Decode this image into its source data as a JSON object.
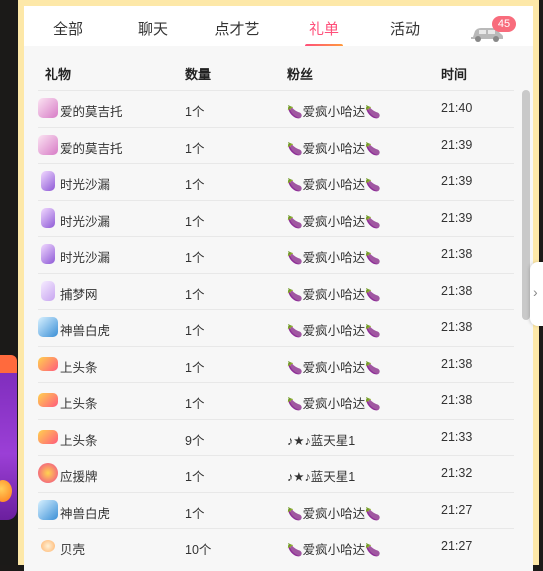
{
  "tabs": [
    {
      "label": "全部"
    },
    {
      "label": "聊天"
    },
    {
      "label": "点才艺"
    },
    {
      "label": "礼单",
      "active": true
    },
    {
      "label": "活动"
    }
  ],
  "car_badge": "45",
  "columns": {
    "gift": "礼物",
    "qty": "数量",
    "fan": "粉丝",
    "time": "时间"
  },
  "rows": [
    {
      "icon": "mozart-gift-icon",
      "gift": "爱的莫吉托",
      "qty": "1个",
      "fan": "🍆爱疯小哈达🍆",
      "time": "21:40"
    },
    {
      "icon": "mozart-gift-icon",
      "gift": "爱的莫吉托",
      "qty": "1个",
      "fan": "🍆爱疯小哈达🍆",
      "time": "21:39"
    },
    {
      "icon": "hourglass-gift-icon",
      "gift": "时光沙漏",
      "qty": "1个",
      "fan": "🍆爱疯小哈达🍆",
      "time": "21:39"
    },
    {
      "icon": "hourglass-gift-icon",
      "gift": "时光沙漏",
      "qty": "1个",
      "fan": "🍆爱疯小哈达🍆",
      "time": "21:39"
    },
    {
      "icon": "hourglass-gift-icon",
      "gift": "时光沙漏",
      "qty": "1个",
      "fan": "🍆爱疯小哈达🍆",
      "time": "21:38"
    },
    {
      "icon": "dreamcatcher-gift-icon",
      "gift": "捕梦网",
      "qty": "1个",
      "fan": "🍆爱疯小哈达🍆",
      "time": "21:38"
    },
    {
      "icon": "tiger-gift-icon",
      "gift": "神兽白虎",
      "qty": "1个",
      "fan": "🍆爱疯小哈达🍆",
      "time": "21:38"
    },
    {
      "icon": "headline-gift-icon",
      "gift": "上头条",
      "qty": "1个",
      "fan": "🍆爱疯小哈达🍆",
      "time": "21:38"
    },
    {
      "icon": "headline-gift-icon",
      "gift": "上头条",
      "qty": "1个",
      "fan": "🍆爱疯小哈达🍆",
      "time": "21:38"
    },
    {
      "icon": "headline-gift-icon",
      "gift": "上头条",
      "qty": "9个",
      "fan": "♪★♪蓝天星1",
      "time": "21:33"
    },
    {
      "icon": "support-sign-gift-icon",
      "gift": "应援牌",
      "qty": "1个",
      "fan": "♪★♪蓝天星1",
      "time": "21:32"
    },
    {
      "icon": "tiger-gift-icon",
      "gift": "神兽白虎",
      "qty": "1个",
      "fan": "🍆爱疯小哈达🍆",
      "time": "21:27"
    },
    {
      "icon": "shell-gift-icon",
      "gift": "贝壳",
      "qty": "10个",
      "fan": "🍆爱疯小哈达🍆",
      "time": "21:27"
    }
  ]
}
